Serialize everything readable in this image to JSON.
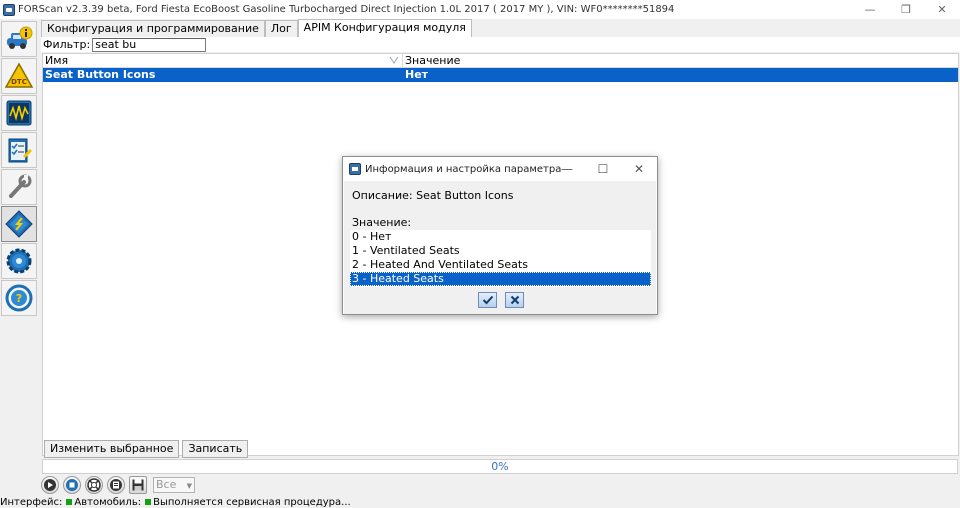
{
  "window": {
    "title": "FORScan v2.3.39 beta, Ford Fiesta EcoBoost Gasoline Turbocharged Direct Injection 1.0L 2017 ( 2017 MY ), VIN: WF0********51894",
    "minimize": "—",
    "maximize": "❐",
    "close": "✕"
  },
  "leftbar": {
    "items": [
      {
        "icon": "vehicle-info-icon"
      },
      {
        "icon": "dtc-warning-icon"
      },
      {
        "icon": "oscilloscope-icon"
      },
      {
        "icon": "checklist-icon"
      },
      {
        "icon": "wrench-icon"
      },
      {
        "icon": "chip-programming-icon"
      },
      {
        "icon": "gear-icon"
      },
      {
        "icon": "help-steering-icon"
      }
    ]
  },
  "tabs": [
    {
      "label": "Конфигурация и программирование",
      "active": false
    },
    {
      "label": "Лог",
      "active": false
    },
    {
      "label": "APIM Конфигурация модуля",
      "active": true
    }
  ],
  "filter": {
    "label": "Фильтр:",
    "value": "seat bu"
  },
  "grid": {
    "columns": [
      "Имя",
      "Значение"
    ],
    "rows": [
      {
        "name": "Seat Button Icons",
        "value": "Нет",
        "selected": true
      }
    ]
  },
  "buttons": {
    "edit_selected": "Изменить выбранное",
    "write": "Записать"
  },
  "progress": {
    "text": "0%",
    "value": 0
  },
  "controls": {
    "filter_select": "Все"
  },
  "status": {
    "interface": "Интерфейс:",
    "vehicle": "Автомобиль:",
    "message": "Выполняется сервисная процедура..."
  },
  "dialog": {
    "title": "Информация и настройка параметра",
    "description": "Описание: Seat Button Icons",
    "value_label": "Значение:",
    "options": [
      "0 - Нет",
      "1 - Ventilated Seats",
      "2 - Heated And Ventilated Seats",
      "3 - Heated Seats"
    ],
    "selected_index": 3,
    "minimize": "—",
    "maximize": "☐",
    "close": "✕"
  },
  "colors": {
    "selection": "#0a62c8",
    "progress_text": "#3b6fc9",
    "status_led": "#14a014"
  }
}
